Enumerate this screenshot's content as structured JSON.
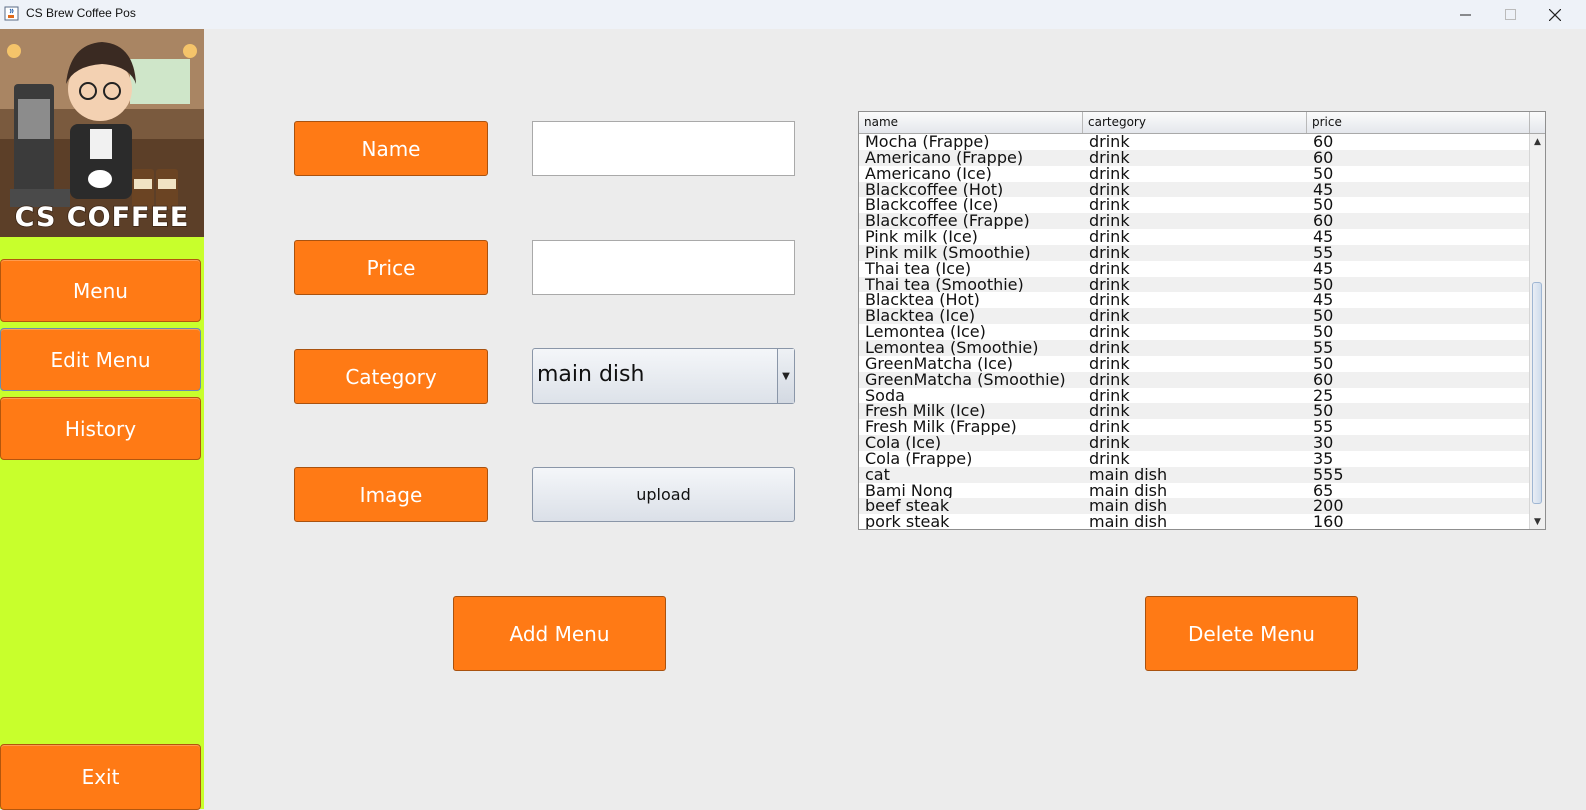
{
  "window": {
    "title": "CS Brew Coffee Pos"
  },
  "sidebar": {
    "logo_text": "CS COFFEE",
    "logo_alt": "Cartoon barista with coffee machine",
    "items": [
      {
        "label": "Menu"
      },
      {
        "label": "Edit Menu"
      },
      {
        "label": "History"
      }
    ],
    "exit_label": "Exit"
  },
  "form": {
    "name_label": "Name",
    "name_value": "",
    "price_label": "Price",
    "price_value": "",
    "category_label": "Category",
    "category_value": "main dish",
    "image_label": "Image",
    "upload_label": "upload"
  },
  "actions": {
    "add_label": "Add Menu",
    "delete_label": "Delete Menu"
  },
  "table": {
    "columns": [
      "name",
      "cartegory",
      "price"
    ],
    "rows": [
      [
        "Mocha (Frappe)",
        "drink",
        "60"
      ],
      [
        "Americano (Frappe)",
        "drink",
        "60"
      ],
      [
        "Americano (Ice)",
        "drink",
        "50"
      ],
      [
        "Blackcoffee (Hot)",
        "drink",
        "45"
      ],
      [
        "Blackcoffee (Ice)",
        "drink",
        "50"
      ],
      [
        "Blackcoffee (Frappe)",
        "drink",
        "60"
      ],
      [
        "Pink milk (Ice)",
        "drink",
        "45"
      ],
      [
        "Pink milk (Smoothie)",
        "drink",
        "55"
      ],
      [
        "Thai tea (Ice)",
        "drink",
        "45"
      ],
      [
        "Thai tea (Smoothie)",
        "drink",
        "50"
      ],
      [
        "Blacktea (Hot)",
        "drink",
        "45"
      ],
      [
        "Blacktea (Ice)",
        "drink",
        "50"
      ],
      [
        "Lemontea (Ice)",
        "drink",
        "50"
      ],
      [
        "Lemontea (Smoothie)",
        "drink",
        "55"
      ],
      [
        "GreenMatcha (Ice)",
        "drink",
        "50"
      ],
      [
        "GreenMatcha (Smoothie)",
        "drink",
        "60"
      ],
      [
        "Soda",
        "drink",
        "25"
      ],
      [
        "Fresh Milk (Ice)",
        "drink",
        "50"
      ],
      [
        "Fresh Milk (Frappe)",
        "drink",
        "55"
      ],
      [
        "Cola (Ice)",
        "drink",
        "30"
      ],
      [
        "Cola (Frappe)",
        "drink",
        "35"
      ],
      [
        "cat",
        "main dish",
        "555"
      ],
      [
        "Bami Nong",
        "main dish",
        "65"
      ],
      [
        "beef steak",
        "main dish",
        "200"
      ],
      [
        "pork steak",
        "main dish",
        "160"
      ]
    ]
  },
  "colors": {
    "accent": "#ff7a15",
    "sidebar": "#c8ff2c",
    "background": "#ececec"
  }
}
